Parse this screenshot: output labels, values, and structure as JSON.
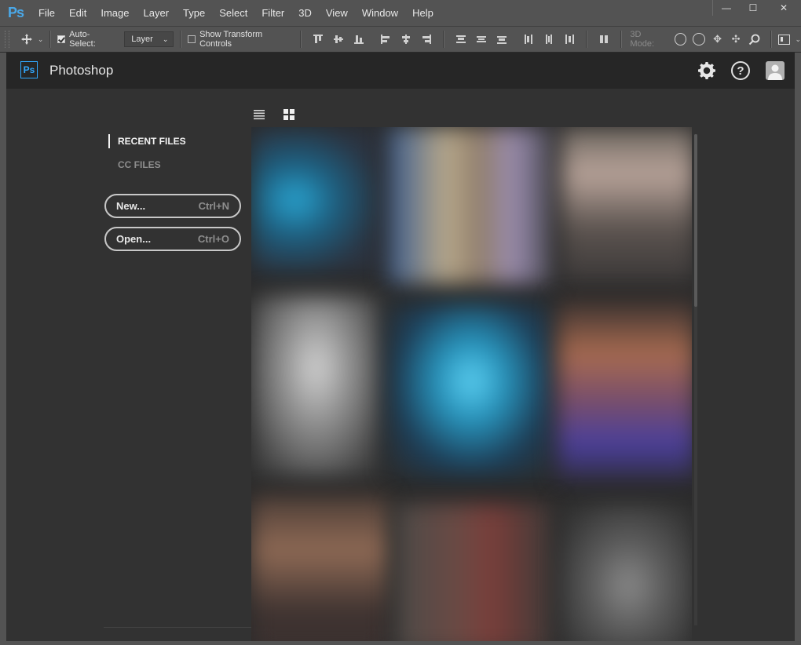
{
  "menubar": {
    "logo": "Ps",
    "items": [
      "File",
      "Edit",
      "Image",
      "Layer",
      "Type",
      "Select",
      "Filter",
      "3D",
      "View",
      "Window",
      "Help"
    ]
  },
  "window_controls": {
    "minimize": "—",
    "maximize": "☐",
    "close": "✕"
  },
  "optionsbar": {
    "auto_select_label": "Auto-Select:",
    "auto_select_checked": true,
    "auto_select_target": "Layer",
    "show_transform_label": "Show Transform Controls",
    "show_transform_checked": false,
    "threed_mode_label": "3D Mode:"
  },
  "workspace": {
    "app_title": "Photoshop",
    "badge": "Ps",
    "help_glyph": "?",
    "nav": {
      "recent_files": "RECENT FILES",
      "cc_files": "CC FILES"
    },
    "new_button": {
      "label": "New...",
      "shortcut": "Ctrl+N"
    },
    "open_button": {
      "label": "Open...",
      "shortcut": "Ctrl+O"
    },
    "view_modes": [
      "list-view",
      "grid-view"
    ],
    "selected_view": "grid-view"
  },
  "colors": {
    "accent": "#31a8ff",
    "header_bg": "#262626",
    "workspace_bg": "#323232",
    "chrome_bg": "#535353"
  }
}
